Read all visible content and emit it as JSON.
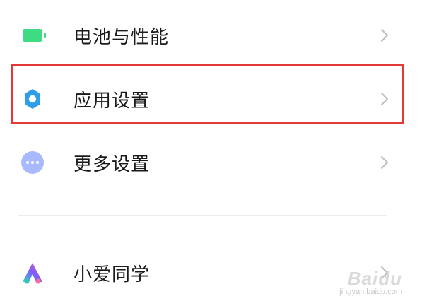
{
  "settings": {
    "items": [
      {
        "label": "电池与性能",
        "icon": "battery-icon",
        "icon_color": "#3ddc84"
      },
      {
        "label": "应用设置",
        "icon": "gear-icon",
        "icon_color": "#2f9ee8",
        "highlighted": true
      },
      {
        "label": "更多设置",
        "icon": "more-dots-icon",
        "icon_color": "#a8b9ff"
      },
      {
        "label": "小爱同学",
        "icon": "xiaoai-icon"
      }
    ]
  },
  "highlight": {
    "color": "#e53935"
  },
  "watermark": {
    "logo": "Baidu",
    "domain": "jingyan.baidu.com"
  }
}
